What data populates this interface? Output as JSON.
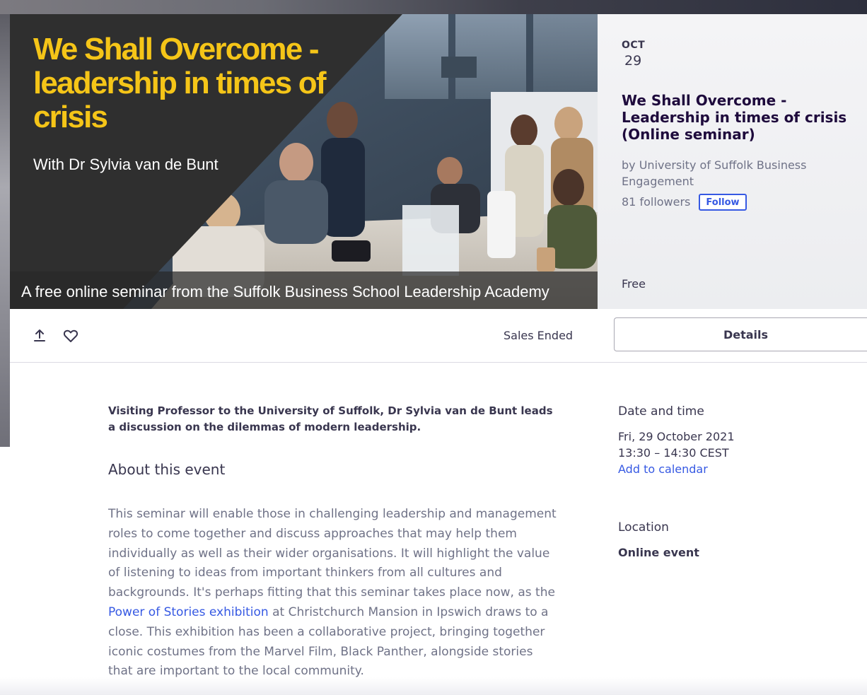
{
  "banner": {
    "title": "We Shall Overcome - leadership in times of crisis",
    "presenter": "With Dr Sylvia van de Bunt",
    "caption": "A free online seminar from the Suffolk Business School Leadership Academy"
  },
  "event": {
    "month": "OCT",
    "day": "29",
    "title": "We Shall Overcome - Leadership in times of crisis (Online seminar)",
    "organizer": "by University of Suffolk Business Engagement",
    "followers": "81 followers",
    "follow_label": "Follow",
    "price": "Free"
  },
  "actions": {
    "share_icon": "share-icon",
    "like_icon": "heart-icon",
    "status": "Sales Ended",
    "details_label": "Details"
  },
  "content": {
    "summary": "Visiting Professor to the University of Suffolk, Dr Sylvia van de Bunt leads a discussion on the dilemmas of modern leadership.",
    "about_title": "About this event",
    "about_p1": "This seminar will enable those in challenging leadership and management roles to come together and discuss approaches that may help them individually as well as their wider organisations. It will highlight the value of listening to ideas from important thinkers from all cultures and backgrounds. It's perhaps fitting that this seminar takes place now, as the ",
    "about_link": "Power of Stories exhibition",
    "about_p2": " at Christchurch Mansion in Ipswich draws to a close. This exhibition has been a collaborative project, bringing together iconic costumes from the Marvel Film, Black Panther, alongside stories that are important to the local community."
  },
  "sidebar": {
    "date_heading": "Date and time",
    "date": "Fri, 29 October 2021",
    "time": "13:30 – 14:30 CEST",
    "calendar_link": "Add to calendar",
    "location_heading": "Location",
    "location": "Online event"
  },
  "colors": {
    "title_yellow": "#f5c518",
    "link_blue": "#3659e3",
    "heading": "#1e0a3c",
    "body_text": "#6f7287"
  }
}
